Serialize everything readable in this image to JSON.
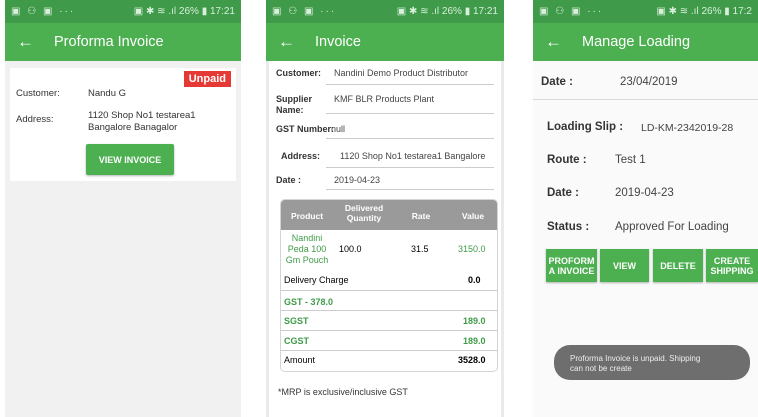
{
  "status_bar": {
    "left": "▣ ⚇ ▣ ···",
    "right": "▣ ✱ ≋ .ıl 26% ▮ 17:21",
    "right_cut": "▣ ✱ ≋ .ıl 26% ▮ 17:2"
  },
  "screen1": {
    "title": "Proforma Invoice",
    "badge": "Unpaid",
    "customer_label": "Customer:",
    "customer_value": "Nandu G",
    "address_label": "Address:",
    "address_line1": "1120 Shop No1 testarea1",
    "address_line2": "Bangalore Banagalor",
    "view_invoice": "VIEW INVOICE"
  },
  "screen2": {
    "title": "Invoice",
    "customer_label": "Customer:",
    "customer_value": "Nandini Demo Product Distributor",
    "supplier_label_1": "Supplier",
    "supplier_label_2": "Name:",
    "supplier_value": "KMF BLR Products Plant",
    "gst_label": "GST Number:",
    "gst_value": "null",
    "address_label": "Address:",
    "address_value": "1120 Shop No1 testarea1 Bangalore",
    "date_label": "Date :",
    "date_value": "2019-04-23",
    "table": {
      "headers": [
        "Product",
        "Delivered Quantity",
        "Rate",
        "Value"
      ],
      "row": {
        "product_1": "Nandini",
        "product_2": "Peda 100",
        "product_3": "Gm Pouch",
        "quantity": "100.0",
        "rate": "31.5",
        "value": "3150.0"
      },
      "delivery_label": "Delivery Charge",
      "delivery_value": "0.0",
      "gst_line": "GST -  378.0",
      "sgst_label": "SGST",
      "sgst_value": "189.0",
      "cgst_label": "CGST",
      "cgst_value": "189.0",
      "amount_label": "Amount",
      "amount_value": "3528.0"
    },
    "note": "*MRP is exclusive/inclusive GST"
  },
  "screen3": {
    "title": "Manage Loading",
    "date_label": "Date :",
    "date_value": "23/04/2019",
    "slip_label": "Loading Slip :",
    "slip_value": "LD-KM-2342019-28",
    "route_label": "Route :",
    "route_value": "Test 1",
    "date2_label": "Date :",
    "date2_value": "2019-04-23",
    "status_label": "Status :",
    "status_value": "Approved For Loading",
    "btn_proforma_1": "PROFORM",
    "btn_proforma_2": "A INVOICE",
    "btn_view": "VIEW",
    "btn_delete": "DELETE",
    "btn_create_1": "CREATE",
    "btn_create_2": "SHIPPING",
    "toast_1": "Proforma Invoice is unpaid. Shipping",
    "toast_2": "can not be create"
  },
  "colors": {
    "primary": "#4caf50",
    "status_bar": "#3f9a49",
    "unpaid": "#e53935",
    "toast": "#6e6e6e"
  }
}
